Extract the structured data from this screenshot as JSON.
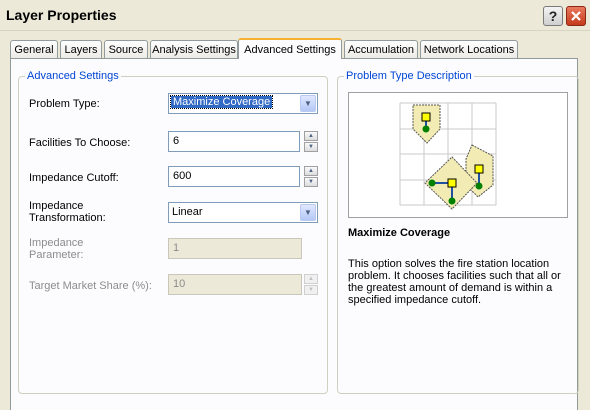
{
  "window": {
    "title": "Layer Properties"
  },
  "tabs": [
    {
      "label": "General"
    },
    {
      "label": "Layers"
    },
    {
      "label": "Source"
    },
    {
      "label": "Analysis Settings"
    },
    {
      "label": "Advanced Settings"
    },
    {
      "label": "Accumulation"
    },
    {
      "label": "Network Locations"
    }
  ],
  "advanced": {
    "legend": "Advanced Settings",
    "problem_type": {
      "label": "Problem Type:",
      "value": "Maximize Coverage"
    },
    "facilities": {
      "label": "Facilities To Choose:",
      "value": "6"
    },
    "cutoff": {
      "label": "Impedance Cutoff:",
      "value": "600"
    },
    "transformation": {
      "label_line1": "Impedance",
      "label_line2": "Transformation:",
      "value": "Linear"
    },
    "parameter": {
      "label_line1": "Impedance",
      "label_line2": "Parameter:",
      "value": "1"
    },
    "market_share": {
      "label": "Target Market Share (%):",
      "value": "10"
    }
  },
  "description": {
    "legend": "Problem Type Description",
    "title": "Maximize Coverage",
    "body": "This option solves the fire station location problem. It chooses facilities such that all or the greatest amount of demand is within a specified impedance cutoff."
  },
  "colors": {
    "accent_blue": "#0046d5",
    "tab_highlight": "#f8b030",
    "facility_yellow": "#ffff00",
    "demand_green": "#008000",
    "coverage_fill": "#f2ecb4"
  },
  "icons": [
    "help-icon",
    "close-icon",
    "dropdown-arrow-icon",
    "spin-up-icon",
    "spin-down-icon"
  ]
}
